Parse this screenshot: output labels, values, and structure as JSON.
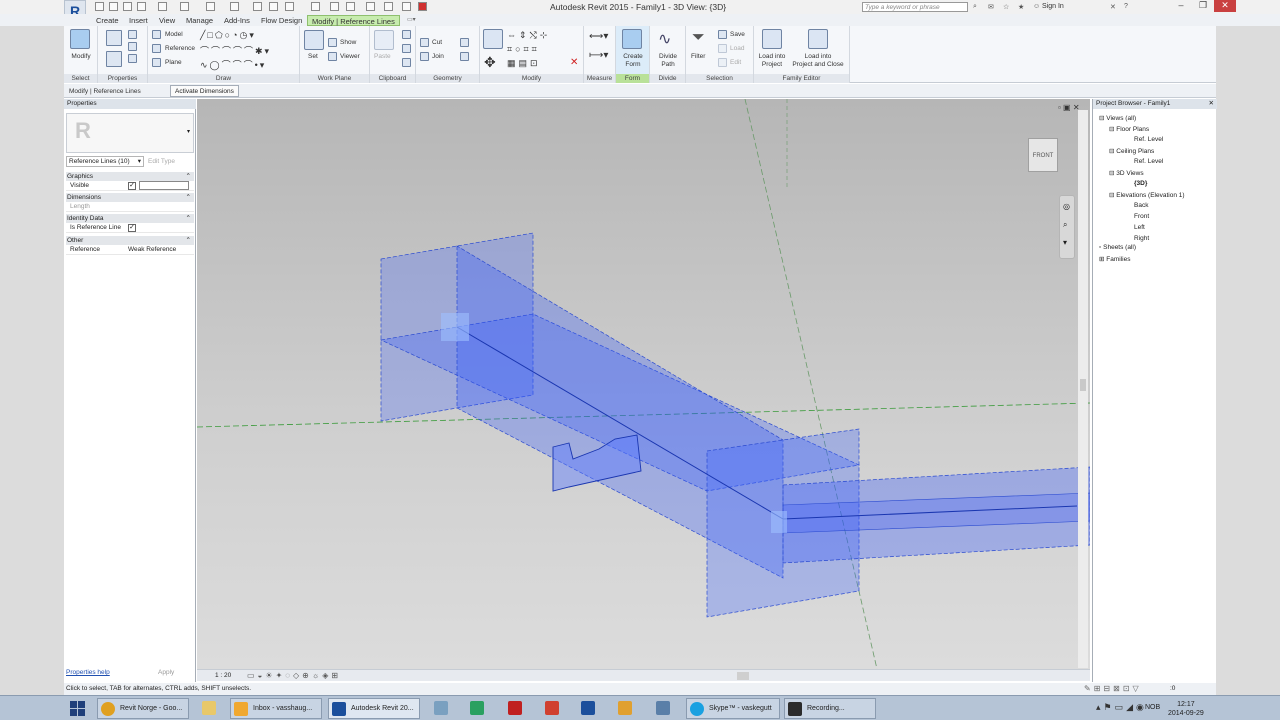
{
  "window": {
    "title": "Autodesk Revit 2015 -     Family1 - 3D View: {3D}",
    "search_placeholder": "Type a keyword or phrase",
    "sign_in": "Sign In"
  },
  "ribbon_tabs": [
    "Create",
    "Insert",
    "View",
    "Manage",
    "Add-Ins",
    "Flow Design",
    "Modify | Reference Lines"
  ],
  "ribbon": {
    "select": {
      "modify": "Modify",
      "label": "Select"
    },
    "properties_label": "Properties",
    "draw": {
      "model": "Model",
      "reference": "Reference",
      "plane": "Plane",
      "label": "Draw"
    },
    "work_plane": {
      "set": "Set",
      "show": "Show",
      "viewer": "Viewer",
      "label": "Work Plane"
    },
    "clipboard": {
      "paste": "Paste",
      "label": "Clipboard"
    },
    "geometry": {
      "cut": "Cut",
      "join": "Join",
      "label": "Geometry"
    },
    "modify_label": "Modify",
    "measure_label": "Measure",
    "form": {
      "create_form_1": "Create",
      "create_form_2": "Form",
      "label": "Form"
    },
    "divide": {
      "divide_1": "Divide",
      "divide_2": "Path",
      "label": "Divide"
    },
    "selection": {
      "filter": "Filter",
      "save": "Save",
      "load": "Load",
      "edit": "Edit",
      "label": "Selection"
    },
    "family_editor": {
      "load_project_1": "Load into",
      "load_project_2": "Project",
      "load_close_1": "Load into",
      "load_close_2": "Project and Close",
      "label": "Family Editor"
    }
  },
  "options_bar": {
    "context": "Modify | Reference Lines",
    "activate_dimensions": "Activate Dimensions"
  },
  "properties": {
    "header": "Properties",
    "type_selector": "Reference Lines (10)",
    "edit_type": "Edit Type",
    "groups": {
      "graphics": "Graphics",
      "dimensions": "Dimensions",
      "identity": "Identity Data",
      "other": "Other"
    },
    "rows": {
      "visible": {
        "key": "Visible",
        "checked": true
      },
      "length": {
        "key": "Length",
        "value": ""
      },
      "is_reference_line": {
        "key": "Is Reference Line",
        "checked": true
      },
      "reference": {
        "key": "Reference",
        "value": "Weak Reference"
      }
    },
    "help": "Properties help",
    "apply": "Apply"
  },
  "viewport": {
    "viewcube_face": "FRONT",
    "scale": "1 : 20",
    "colors": {
      "solid": "#2f5cff",
      "edge": "#1f3fb0",
      "ref_line_green": "#3a9a3a"
    }
  },
  "project_browser": {
    "header": "Project Browser - Family1",
    "tree": [
      {
        "label": "Views (all)",
        "level": 0
      },
      {
        "label": "Floor Plans",
        "level": 1
      },
      {
        "label": "Ref. Level",
        "level": 2
      },
      {
        "label": "Ceiling Plans",
        "level": 1
      },
      {
        "label": "Ref. Level",
        "level": 2
      },
      {
        "label": "3D Views",
        "level": 1
      },
      {
        "label": "{3D}",
        "level": 2,
        "selected": true
      },
      {
        "label": "Elevations (Elevation 1)",
        "level": 1
      },
      {
        "label": "Back",
        "level": 2
      },
      {
        "label": "Front",
        "level": 2
      },
      {
        "label": "Left",
        "level": 2
      },
      {
        "label": "Right",
        "level": 2
      },
      {
        "label": "Sheets (all)",
        "level": 0
      },
      {
        "label": "Families",
        "level": 0
      }
    ]
  },
  "status": {
    "text": "Click to select, TAB for alternates, CTRL adds, SHIFT unselects.",
    "filter_count": ":0"
  },
  "taskbar": {
    "tasks": [
      {
        "label": "Revit Norge - Goo...",
        "icon_color": "#e0a020"
      },
      {
        "label": "Inbox - vasshaug...",
        "icon_color": "#f0a830"
      },
      {
        "label": "Autodesk Revit 20...",
        "icon_color": "#1b4f9c",
        "active": true
      },
      {
        "label": "Skype™ - vaskegutt",
        "icon_color": "#1aa1e1"
      },
      {
        "label": "Recording...",
        "icon_color": "#2b2b2b"
      }
    ],
    "language": "NOB",
    "time": "12:17",
    "date": "2014-09-29"
  }
}
